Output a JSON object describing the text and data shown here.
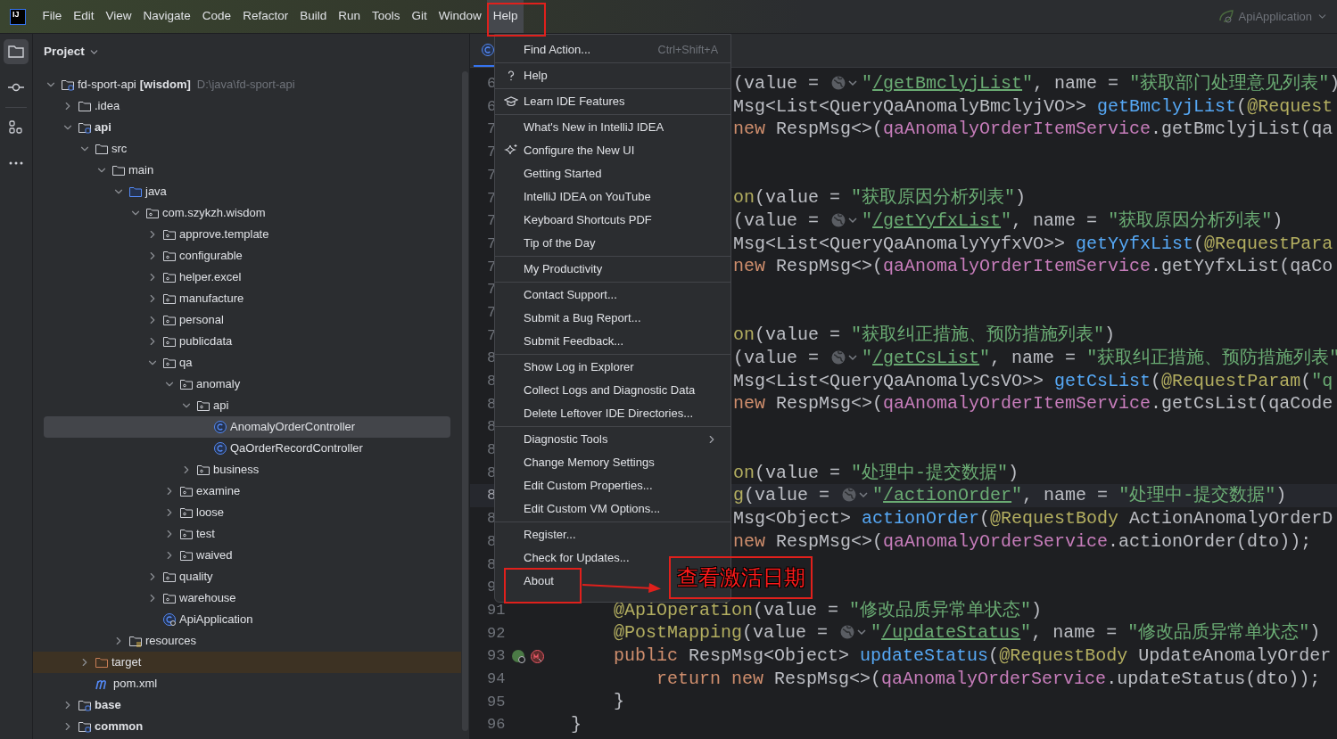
{
  "menu_bar": {
    "logo": "IJ",
    "items": [
      {
        "label": "File",
        "selected": false
      },
      {
        "label": "Edit",
        "selected": false
      },
      {
        "label": "View",
        "selected": false
      },
      {
        "label": "Navigate",
        "selected": false
      },
      {
        "label": "Code",
        "selected": false
      },
      {
        "label": "Refactor",
        "selected": false
      },
      {
        "label": "Build",
        "selected": false
      },
      {
        "label": "Run",
        "selected": false
      },
      {
        "label": "Tools",
        "selected": false
      },
      {
        "label": "Git",
        "selected": false
      },
      {
        "label": "Window",
        "selected": false
      },
      {
        "label": "Help",
        "selected": true
      }
    ],
    "run_config": "ApiApplication"
  },
  "tool_strip": [
    {
      "selected": true
    },
    {
      "selected": false
    },
    {
      "selected": false
    },
    {
      "selected": false
    }
  ],
  "project_panel": {
    "title": "Project",
    "tree": [
      {
        "name": "fd-sport-api",
        "badge": "[wisdom]",
        "path": "D:\\java\\fd-sport-api",
        "kind": "module",
        "expanded": true,
        "selected": false,
        "children": [
          {
            "name": ".idea",
            "kind": "folder",
            "expanded": false,
            "selected": false
          },
          {
            "name": "api",
            "kind": "module",
            "expanded": true,
            "selected": false,
            "children": [
              {
                "name": "src",
                "kind": "folder",
                "expanded": true,
                "selected": false,
                "children": [
                  {
                    "name": "main",
                    "kind": "folder",
                    "expanded": true,
                    "selected": false,
                    "children": [
                      {
                        "name": "java",
                        "kind": "source",
                        "expanded": true,
                        "selected": false,
                        "children": [
                          {
                            "name": "com.szykzh.wisdom",
                            "kind": "package",
                            "expanded": true,
                            "selected": false,
                            "children": [
                              {
                                "name": "approve.template",
                                "kind": "package",
                                "expanded": false,
                                "selected": false
                              },
                              {
                                "name": "configurable",
                                "kind": "package",
                                "expanded": false,
                                "selected": false
                              },
                              {
                                "name": "helper.excel",
                                "kind": "package",
                                "expanded": false,
                                "selected": false
                              },
                              {
                                "name": "manufacture",
                                "kind": "package",
                                "expanded": false,
                                "selected": false
                              },
                              {
                                "name": "personal",
                                "kind": "package",
                                "expanded": false,
                                "selected": false
                              },
                              {
                                "name": "publicdata",
                                "kind": "package",
                                "expanded": false,
                                "selected": false
                              },
                              {
                                "name": "qa",
                                "kind": "package",
                                "expanded": true,
                                "selected": false,
                                "children": [
                                  {
                                    "name": "anomaly",
                                    "kind": "package",
                                    "expanded": true,
                                    "selected": false,
                                    "children": [
                                      {
                                        "name": "api",
                                        "kind": "package",
                                        "expanded": true,
                                        "selected": false,
                                        "children": [
                                          {
                                            "name": "AnomalyOrderController",
                                            "kind": "class",
                                            "selected": true
                                          },
                                          {
                                            "name": "QaOrderRecordController",
                                            "kind": "class",
                                            "selected": false
                                          }
                                        ]
                                      },
                                      {
                                        "name": "business",
                                        "kind": "package",
                                        "expanded": false,
                                        "selected": false
                                      }
                                    ]
                                  },
                                  {
                                    "name": "examine",
                                    "kind": "package",
                                    "expanded": false,
                                    "selected": false
                                  },
                                  {
                                    "name": "loose",
                                    "kind": "package",
                                    "expanded": false,
                                    "selected": false
                                  },
                                  {
                                    "name": "test",
                                    "kind": "package",
                                    "expanded": false,
                                    "selected": false
                                  },
                                  {
                                    "name": "waived",
                                    "kind": "package",
                                    "expanded": false,
                                    "selected": false
                                  }
                                ]
                              },
                              {
                                "name": "quality",
                                "kind": "package",
                                "expanded": false,
                                "selected": false
                              },
                              {
                                "name": "warehouse",
                                "kind": "package",
                                "expanded": false,
                                "selected": false
                              },
                              {
                                "name": "ApiApplication",
                                "kind": "app",
                                "selected": false
                              }
                            ]
                          }
                        ]
                      },
                      {
                        "name": "resources",
                        "kind": "resources",
                        "expanded": false,
                        "selected": false
                      }
                    ]
                  }
                ]
              },
              {
                "name": "target",
                "kind": "excluded",
                "expanded": false,
                "selected": false
              },
              {
                "name": "pom.xml",
                "kind": "maven",
                "selected": false
              }
            ]
          },
          {
            "name": "base",
            "kind": "module",
            "expanded": false,
            "selected": false
          },
          {
            "name": "common",
            "kind": "module",
            "expanded": false,
            "selected": false
          }
        ]
      }
    ]
  },
  "editor": {
    "lines": [
      {
        "number": "6",
        "kind": "clipped",
        "current": false,
        "segments": [
          {
            "text": "(value = ",
            "kind": "plain"
          },
          {
            "kind": "globe"
          },
          {
            "text": "\"",
            "kind": "string"
          },
          {
            "text": "/getBmclyjList",
            "kind": "link"
          },
          {
            "text": "\"",
            "kind": "string"
          },
          {
            "text": ", name = ",
            "kind": "plain"
          },
          {
            "text": "\"获取部门处理意见列表\"",
            "kind": "string"
          },
          {
            "text": ")",
            "kind": "plain"
          }
        ]
      },
      {
        "number": "6",
        "kind": "clipped",
        "current": false,
        "segments": [
          {
            "text": "Msg<List<QueryQaAnomalyBmclyjVO>> ",
            "kind": "plain"
          },
          {
            "text": "getBmclyjList",
            "kind": "method"
          },
          {
            "text": "(",
            "kind": "plain"
          },
          {
            "text": "@Request",
            "kind": "annotation"
          }
        ]
      },
      {
        "number": "7",
        "kind": "clipped",
        "current": false,
        "segments": [
          {
            "text": "new",
            "kind": "keyword"
          },
          {
            "text": " RespMsg<>(",
            "kind": "plain"
          },
          {
            "text": "qaAnomalyOrderItemService",
            "kind": "field"
          },
          {
            "text": ".getBmclyjList(qa",
            "kind": "plain"
          }
        ]
      },
      {
        "number": "7",
        "current": false
      },
      {
        "number": "7",
        "current": false
      },
      {
        "number": "7",
        "kind": "clipped",
        "current": false,
        "segments": [
          {
            "text": "on",
            "kind": "annotation"
          },
          {
            "text": "(value = ",
            "kind": "plain"
          },
          {
            "text": "\"获取原因分析列表\"",
            "kind": "string"
          },
          {
            "text": ")",
            "kind": "plain"
          }
        ]
      },
      {
        "number": "7",
        "kind": "clipped",
        "current": false,
        "segments": [
          {
            "text": "(value = ",
            "kind": "plain"
          },
          {
            "kind": "globe"
          },
          {
            "text": "\"",
            "kind": "string"
          },
          {
            "text": "/getYyfxList",
            "kind": "link"
          },
          {
            "text": "\"",
            "kind": "string"
          },
          {
            "text": ", name = ",
            "kind": "plain"
          },
          {
            "text": "\"获取原因分析列表\"",
            "kind": "string"
          },
          {
            "text": ")",
            "kind": "plain"
          }
        ]
      },
      {
        "number": "7",
        "kind": "clipped",
        "current": false,
        "segments": [
          {
            "text": "Msg<List<QueryQaAnomalyYyfxVO>> ",
            "kind": "plain"
          },
          {
            "text": "getYyfxList",
            "kind": "method"
          },
          {
            "text": "(",
            "kind": "plain"
          },
          {
            "text": "@RequestPara",
            "kind": "annotation"
          }
        ]
      },
      {
        "number": "7",
        "kind": "clipped",
        "current": false,
        "segments": [
          {
            "text": "new",
            "kind": "keyword"
          },
          {
            "text": " RespMsg<>(",
            "kind": "plain"
          },
          {
            "text": "qaAnomalyOrderItemService",
            "kind": "field"
          },
          {
            "text": ".getYyfxList(qaCo",
            "kind": "plain"
          }
        ]
      },
      {
        "number": "7",
        "current": false
      },
      {
        "number": "7",
        "current": false
      },
      {
        "number": "7",
        "kind": "clipped",
        "current": false,
        "segments": [
          {
            "text": "on",
            "kind": "annotation"
          },
          {
            "text": "(value = ",
            "kind": "plain"
          },
          {
            "text": "\"获取纠正措施、预防措施列表\"",
            "kind": "string"
          },
          {
            "text": ")",
            "kind": "plain"
          }
        ]
      },
      {
        "number": "8",
        "kind": "clipped",
        "current": false,
        "segments": [
          {
            "text": "(value = ",
            "kind": "plain"
          },
          {
            "kind": "globe"
          },
          {
            "text": "\"",
            "kind": "string"
          },
          {
            "text": "/getCsList",
            "kind": "link"
          },
          {
            "text": "\"",
            "kind": "string"
          },
          {
            "text": ", name = ",
            "kind": "plain"
          },
          {
            "text": "\"获取纠正措施、预防措施列表\"",
            "kind": "string"
          }
        ]
      },
      {
        "number": "8",
        "kind": "clipped",
        "current": false,
        "segments": [
          {
            "text": "Msg<List<QueryQaAnomalyCsVO>> ",
            "kind": "plain"
          },
          {
            "text": "getCsList",
            "kind": "method"
          },
          {
            "text": "(",
            "kind": "plain"
          },
          {
            "text": "@RequestParam",
            "kind": "annotation"
          },
          {
            "text": "(",
            "kind": "plain"
          },
          {
            "text": "\"q",
            "kind": "string"
          }
        ]
      },
      {
        "number": "8",
        "kind": "clipped",
        "current": false,
        "segments": [
          {
            "text": "new",
            "kind": "keyword"
          },
          {
            "text": " RespMsg<>(",
            "kind": "plain"
          },
          {
            "text": "qaAnomalyOrderItemService",
            "kind": "field"
          },
          {
            "text": ".getCsList(qaCode",
            "kind": "plain"
          }
        ]
      },
      {
        "number": "8",
        "current": false
      },
      {
        "number": "8",
        "current": false
      },
      {
        "number": "8",
        "kind": "clipped",
        "current": false,
        "segments": [
          {
            "text": "on",
            "kind": "annotation"
          },
          {
            "text": "(value = ",
            "kind": "plain"
          },
          {
            "text": "\"处理中-提交数据\"",
            "kind": "string"
          },
          {
            "text": ")",
            "kind": "plain"
          }
        ]
      },
      {
        "number": "8",
        "kind": "clipped",
        "current": true,
        "segments": [
          {
            "text": "g",
            "kind": "annotation"
          },
          {
            "text": "(value = ",
            "kind": "plain"
          },
          {
            "kind": "globe"
          },
          {
            "text": "\"",
            "kind": "string"
          },
          {
            "text": "/actionOrder",
            "kind": "link"
          },
          {
            "text": "\"",
            "kind": "string"
          },
          {
            "text": ", name = ",
            "kind": "plain"
          },
          {
            "text": "\"处理中-提交数据\"",
            "kind": "string"
          },
          {
            "text": ")",
            "kind": "plain"
          }
        ]
      },
      {
        "number": "8",
        "kind": "clipped",
        "current": false,
        "segments": [
          {
            "text": "Msg<Object> ",
            "kind": "plain"
          },
          {
            "text": "actionOrder",
            "kind": "method"
          },
          {
            "text": "(",
            "kind": "plain"
          },
          {
            "text": "@RequestBody",
            "kind": "annotation"
          },
          {
            "text": " ActionAnomalyOrderD",
            "kind": "plain"
          }
        ]
      },
      {
        "number": "8",
        "kind": "clipped",
        "current": false,
        "segments": [
          {
            "text": "new",
            "kind": "keyword"
          },
          {
            "text": " RespMsg<>(",
            "kind": "plain"
          },
          {
            "text": "qaAnomalyOrderService",
            "kind": "field"
          },
          {
            "text": ".actionOrder(dto));",
            "kind": "plain"
          }
        ]
      },
      {
        "number": "8",
        "current": false
      },
      {
        "number": "9",
        "current": false
      },
      {
        "number": "91",
        "kind": "full",
        "current": false,
        "markers": false,
        "segments": [
          {
            "text": "    @ApiOperation",
            "kind": "annotation"
          },
          {
            "text": "(value = ",
            "kind": "plain"
          },
          {
            "text": "\"修改品质异常单状态\"",
            "kind": "string"
          },
          {
            "text": ")",
            "kind": "plain"
          }
        ]
      },
      {
        "number": "92",
        "kind": "full",
        "current": false,
        "markers": false,
        "segments": [
          {
            "text": "    @PostMapping",
            "kind": "annotation"
          },
          {
            "text": "(value = ",
            "kind": "plain"
          },
          {
            "kind": "globe"
          },
          {
            "text": "\"",
            "kind": "string"
          },
          {
            "text": "/updateStatus",
            "kind": "link"
          },
          {
            "text": "\"",
            "kind": "string"
          },
          {
            "text": ", name = ",
            "kind": "plain"
          },
          {
            "text": "\"修改品质异常单状态\"",
            "kind": "string"
          },
          {
            "text": ")",
            "kind": "plain"
          }
        ]
      },
      {
        "number": "93",
        "kind": "full",
        "current": false,
        "markers": true,
        "segments": [
          {
            "text": "    public",
            "kind": "keyword"
          },
          {
            "text": " RespMsg<Object> ",
            "kind": "plain"
          },
          {
            "text": "updateStatus",
            "kind": "method"
          },
          {
            "text": "(",
            "kind": "plain"
          },
          {
            "text": "@RequestBody",
            "kind": "annotation"
          },
          {
            "text": " UpdateAnomalyOrder",
            "kind": "plain"
          }
        ]
      },
      {
        "number": "94",
        "kind": "full",
        "current": false,
        "markers": false,
        "segments": [
          {
            "text": "        return new",
            "kind": "keyword"
          },
          {
            "text": " RespMsg<>(",
            "kind": "plain"
          },
          {
            "text": "qaAnomalyOrderService",
            "kind": "field"
          },
          {
            "text": ".updateStatus(dto));",
            "kind": "plain"
          }
        ]
      },
      {
        "number": "95",
        "kind": "full",
        "current": false,
        "markers": false,
        "segments": [
          {
            "text": "    }",
            "kind": "plain"
          }
        ]
      },
      {
        "number": "96",
        "kind": "full",
        "current": false,
        "markers": false,
        "segments": [
          {
            "text": "}",
            "kind": "plain"
          }
        ]
      }
    ]
  },
  "help_menu": {
    "items": [
      {
        "kind": "item",
        "label": "Find Action...",
        "shortcut": "Ctrl+Shift+A"
      },
      {
        "kind": "separator"
      },
      {
        "kind": "item",
        "label": "Help"
      },
      {
        "kind": "separator"
      },
      {
        "kind": "item",
        "label": "Learn IDE Features"
      },
      {
        "kind": "separator"
      },
      {
        "kind": "item",
        "label": "What's New in IntelliJ IDEA"
      },
      {
        "kind": "item",
        "label": "Configure the New UI"
      },
      {
        "kind": "item",
        "label": "Getting Started"
      },
      {
        "kind": "item",
        "label": "IntelliJ IDEA on YouTube"
      },
      {
        "kind": "item",
        "label": "Keyboard Shortcuts PDF"
      },
      {
        "kind": "item",
        "label": "Tip of the Day"
      },
      {
        "kind": "separator"
      },
      {
        "kind": "item",
        "label": "My Productivity"
      },
      {
        "kind": "separator"
      },
      {
        "kind": "item",
        "label": "Contact Support..."
      },
      {
        "kind": "item",
        "label": "Submit a Bug Report..."
      },
      {
        "kind": "item",
        "label": "Submit Feedback..."
      },
      {
        "kind": "separator"
      },
      {
        "kind": "item",
        "label": "Show Log in Explorer"
      },
      {
        "kind": "item",
        "label": "Collect Logs and Diagnostic Data"
      },
      {
        "kind": "item",
        "label": "Delete Leftover IDE Directories..."
      },
      {
        "kind": "separator"
      },
      {
        "kind": "submenu",
        "label": "Diagnostic Tools"
      },
      {
        "kind": "item",
        "label": "Change Memory Settings"
      },
      {
        "kind": "item",
        "label": "Edit Custom Properties..."
      },
      {
        "kind": "item",
        "label": "Edit Custom VM Options..."
      },
      {
        "kind": "separator"
      },
      {
        "kind": "item",
        "label": "Register..."
      },
      {
        "kind": "item",
        "label": "Check for Updates..."
      },
      {
        "kind": "item",
        "label": "About"
      }
    ]
  },
  "annotation": {
    "note": "查看激活日期"
  }
}
